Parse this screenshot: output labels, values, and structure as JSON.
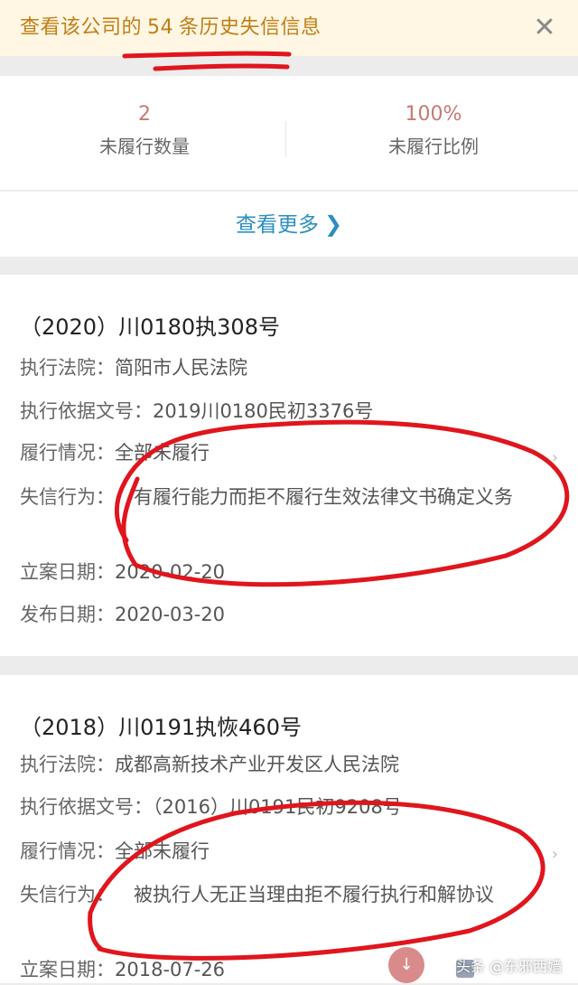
{
  "banner": {
    "prefix": "查看该公司的",
    "count": "54",
    "suffix": "条历史失信信息",
    "close_glyph": "✕"
  },
  "stats": {
    "left": {
      "value": "2",
      "label": "未履行数量"
    },
    "right": {
      "value": "100%",
      "label": "未履行比例"
    }
  },
  "more": {
    "label": "查看更多",
    "icon": "chevron-right-icon"
  },
  "cases": [
    {
      "title": "（2020）川0180执308号",
      "court_label": "执行法院：",
      "court": "简阳市人民法院",
      "basis_label": "执行依据文号：",
      "basis": "2019川0180民初3376号",
      "status_label": "履行情况：",
      "status": "全部未履行",
      "behavior_label": "失信行为：",
      "behavior": "有履行能力而拒不履行生效法律文书确定义务",
      "filed_label": "立案日期：",
      "filed": "2020-02-20",
      "published_label": "发布日期：",
      "published": "2020-03-20"
    },
    {
      "title": "（2018）川0191执恢460号",
      "court_label": "执行法院：",
      "court": "成都高新技术产业开发区人民法院",
      "basis_label": "执行依据文号：",
      "basis": "（2016）川0191民初9208号",
      "status_label": "履行情况：",
      "status": "全部未履行",
      "behavior_label": "失信行为：",
      "behavior": "被执行人无正当理由拒不履行执行和解协议",
      "filed_label": "立案日期：",
      "filed": "2018-07-26"
    }
  ],
  "watermark": "头条 @东邪西嫱",
  "colors": {
    "banner_bg": "#fff6e4",
    "banner_text": "#c07f14",
    "link_blue": "#2b8fbe",
    "stat_value": "#c77a74",
    "annotation_red": "#e0151d"
  }
}
